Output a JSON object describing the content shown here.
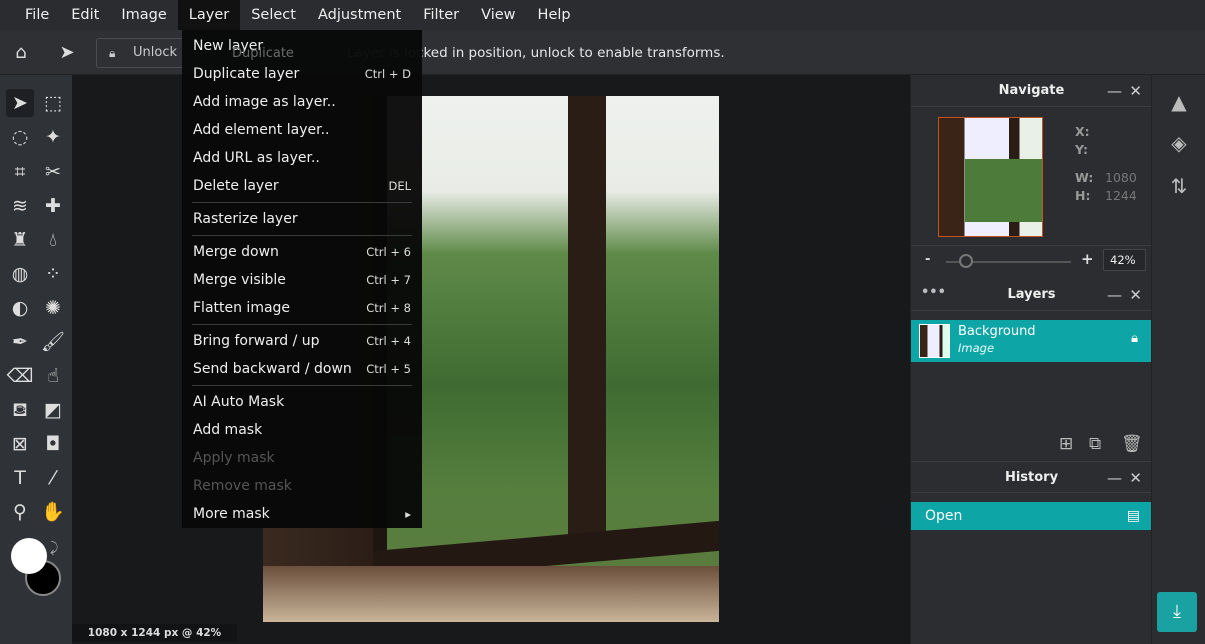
{
  "menubar": {
    "items": [
      "File",
      "Edit",
      "Image",
      "Layer",
      "Select",
      "Adjustment",
      "Filter",
      "View",
      "Help"
    ],
    "active": "Layer"
  },
  "options": {
    "unlock_label": "Unlock",
    "duplicate_label": "Duplicate",
    "message": "Layer is locked in position, unlock to enable transforms."
  },
  "layer_menu": {
    "items": [
      {
        "label": "New layer",
        "shortcut": ""
      },
      {
        "label": "Duplicate layer",
        "shortcut": "Ctrl + D"
      },
      {
        "label": "Add image as layer..",
        "shortcut": ""
      },
      {
        "label": "Add element layer..",
        "shortcut": ""
      },
      {
        "label": "Add URL as layer..",
        "shortcut": ""
      },
      {
        "label": "Delete layer",
        "shortcut": "DEL"
      },
      {
        "label": "Rasterize layer",
        "shortcut": ""
      },
      {
        "label": "Merge down",
        "shortcut": "Ctrl + 6"
      },
      {
        "label": "Merge visible",
        "shortcut": "Ctrl + 7"
      },
      {
        "label": "Flatten image",
        "shortcut": "Ctrl + 8"
      },
      {
        "label": "Bring forward / up",
        "shortcut": "Ctrl + 4"
      },
      {
        "label": "Send backward / down",
        "shortcut": "Ctrl + 5"
      },
      {
        "label": "AI Auto Mask",
        "shortcut": ""
      },
      {
        "label": "Add mask",
        "shortcut": ""
      },
      {
        "label": "Apply mask",
        "shortcut": "",
        "disabled": true
      },
      {
        "label": "Remove mask",
        "shortcut": "",
        "disabled": true
      },
      {
        "label": "More mask",
        "shortcut": "▸"
      }
    ]
  },
  "status": "1080 x 1244 px @ 42%",
  "navigate": {
    "title": "Navigate",
    "x_label": "X:",
    "y_label": "Y:",
    "w_label": "W:",
    "h_label": "H:",
    "w": "1080",
    "h": "1244",
    "zoom": "42%",
    "minus": "-",
    "plus": "+"
  },
  "layers": {
    "title": "Layers",
    "items": [
      {
        "name": "Background",
        "type": "Image",
        "locked": true
      }
    ]
  },
  "history": {
    "title": "History",
    "items": [
      "Open"
    ]
  },
  "colors": {
    "accent": "#0ea5a6",
    "foreground": "#ffffff",
    "background": "#000000"
  }
}
